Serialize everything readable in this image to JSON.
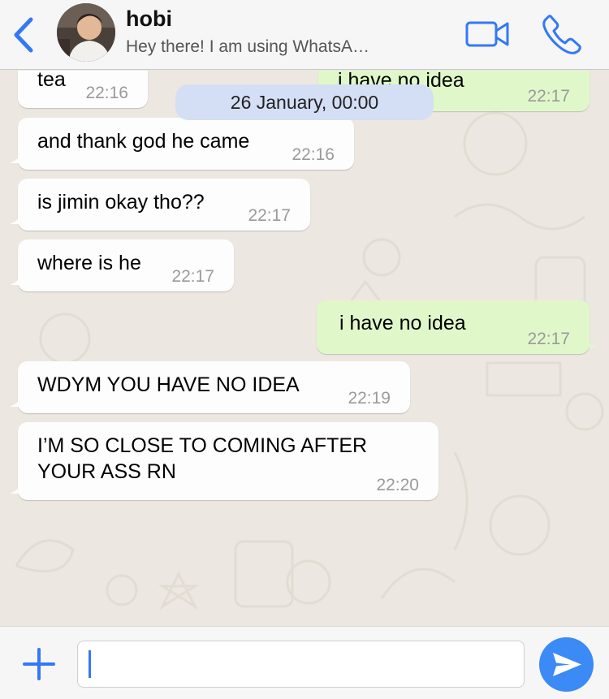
{
  "header": {
    "contact_name": "hobi",
    "status": "Hey there! I am using WhatsA…",
    "accent_color": "#3478f6"
  },
  "chat": {
    "date_pill": "26 January, 00:00",
    "messages": [
      {
        "direction": "incoming",
        "text": "tea",
        "time": "22:16"
      },
      {
        "direction": "outgoing",
        "text": "i have no idea",
        "time": "22:17"
      },
      {
        "direction": "incoming",
        "text": "and thank god he came",
        "time": "22:16"
      },
      {
        "direction": "incoming",
        "text": "is jimin okay tho??",
        "time": "22:17"
      },
      {
        "direction": "incoming",
        "text": "where is he",
        "time": "22:17"
      },
      {
        "direction": "outgoing",
        "text": "i have no idea",
        "time": "22:17"
      },
      {
        "direction": "incoming",
        "text": "WDYM YOU HAVE NO IDEA",
        "time": "22:19"
      },
      {
        "direction": "incoming",
        "text_lines": [
          "I’M SO CLOSE TO COMING AFTER",
          "YOUR ASS RN"
        ],
        "time": "22:20"
      }
    ],
    "colors": {
      "incoming": "#fdfdfd",
      "outgoing": "#e0f8c9",
      "date_pill": "#d4def4"
    }
  },
  "input": {
    "value": "",
    "placeholder": ""
  },
  "icons": {
    "back": "chevron-left-icon",
    "video": "video-camera-icon",
    "call": "phone-icon",
    "attach": "plus-icon",
    "send": "send-arrow-icon"
  }
}
